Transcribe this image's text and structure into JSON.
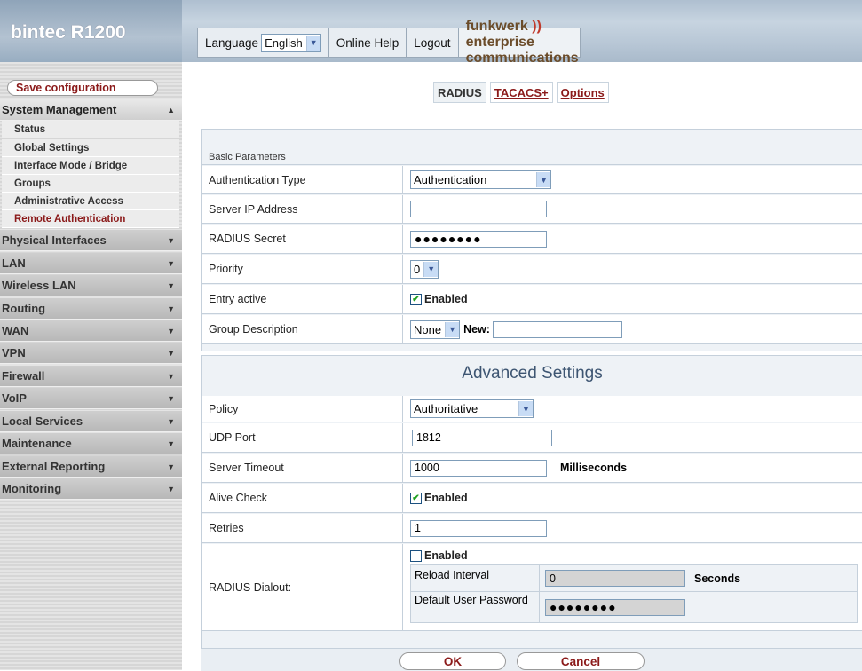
{
  "header": {
    "brand": "bintec R1200",
    "language_label": "Language",
    "language_value": "English",
    "online_help": "Online Help",
    "logout": "Logout",
    "logo_text": "funkwerk",
    "logo_sub": "enterprise communications"
  },
  "sidebar": {
    "save": "Save configuration",
    "system_management": "System Management",
    "sub": [
      "Status",
      "Global Settings",
      "Interface Mode / Bridge",
      "Groups",
      "Administrative Access",
      "Remote Authentication"
    ],
    "menus": [
      "Physical Interfaces",
      "LAN",
      "Wireless LAN",
      "Routing",
      "WAN",
      "VPN",
      "Firewall",
      "VoIP",
      "Local Services",
      "Maintenance",
      "External Reporting",
      "Monitoring"
    ]
  },
  "tabs": [
    "RADIUS",
    "TACACS+",
    "Options"
  ],
  "basic": {
    "section_title": "Basic Parameters",
    "auth_type_label": "Authentication Type",
    "auth_type_value": "Authentication",
    "server_ip_label": "Server IP Address",
    "server_ip_value": "",
    "secret_label": "RADIUS Secret",
    "secret_value": "●●●●●●●●",
    "priority_label": "Priority",
    "priority_value": "0",
    "entry_active_label": "Entry active",
    "enabled_text": "Enabled",
    "group_desc_label": "Group Description",
    "group_desc_value": "None",
    "new_label": "New:",
    "new_value": ""
  },
  "advanced": {
    "title": "Advanced Settings",
    "policy_label": "Policy",
    "policy_value": "Authoritative",
    "udp_port_label": "UDP Port",
    "udp_port_value": "1812",
    "timeout_label": "Server Timeout",
    "timeout_value": "1000",
    "timeout_unit": "Milliseconds",
    "alive_check_label": "Alive Check",
    "retries_label": "Retries",
    "retries_value": "1",
    "dialout_label": "RADIUS Dialout:",
    "reload_label": "Reload Interval",
    "reload_value": "0",
    "reload_unit": "Seconds",
    "default_pw_label": "Default User Password",
    "default_pw_value": "●●●●●●●●",
    "enabled_text": "Enabled"
  },
  "footer": {
    "ok": "OK",
    "cancel": "Cancel"
  },
  "colors": {
    "link": "#8b1a1a",
    "accent": "#3d5572"
  }
}
